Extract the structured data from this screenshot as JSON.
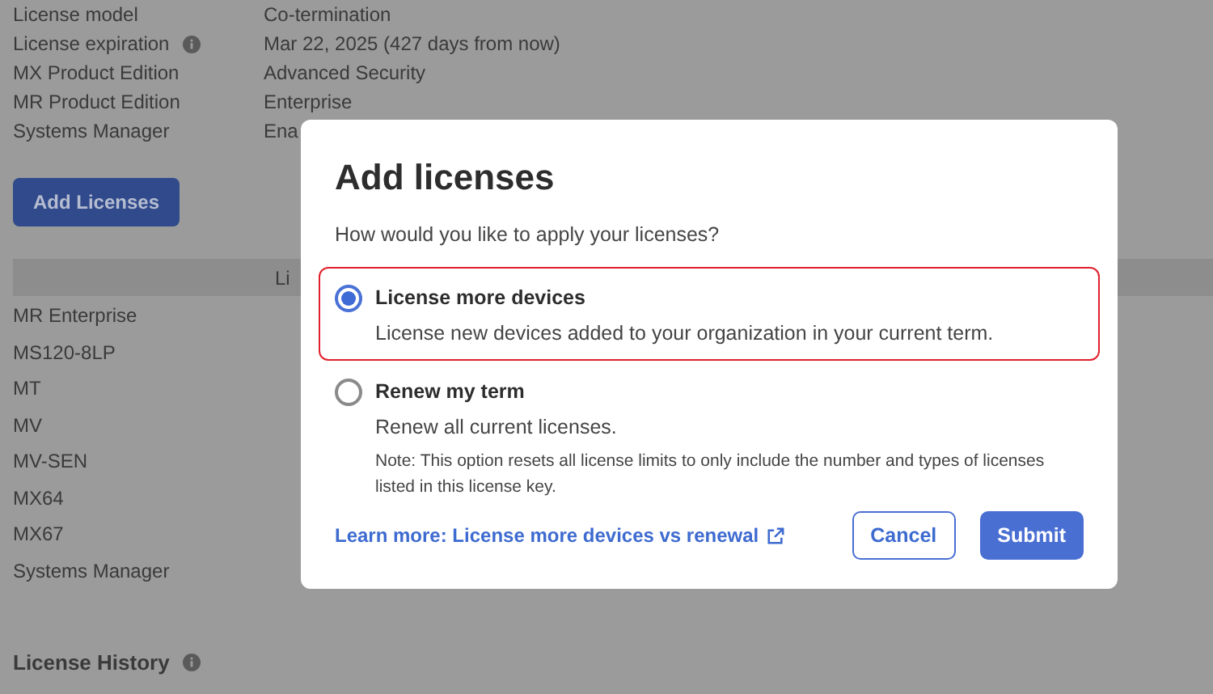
{
  "details": [
    {
      "label": "License model",
      "value": "Co-termination",
      "info": false
    },
    {
      "label": "License expiration",
      "value": "Mar 22, 2025 (427 days from now)",
      "info": true
    },
    {
      "label": "MX Product Edition",
      "value": "Advanced Security",
      "info": false
    },
    {
      "label": "MR Product Edition",
      "value": "Enterprise",
      "info": false
    },
    {
      "label": "Systems Manager",
      "value": "Ena",
      "info": false
    }
  ],
  "add_button": "Add Licenses",
  "table": {
    "header": "Li",
    "rows": [
      "MR Enterprise",
      "MS120-8LP",
      "MT",
      "MV",
      "MV-SEN",
      "MX64",
      "MX67",
      "Systems Manager"
    ]
  },
  "history_title": "License History",
  "dialog": {
    "title": "Add licenses",
    "question": "How would you like to apply your licenses?",
    "options": [
      {
        "label": "License more devices",
        "description": "License new devices added to your organization in your current term.",
        "selected": true
      },
      {
        "label": "Renew my term",
        "description": "Renew all current licenses.",
        "note": "Note: This option resets all license limits to only include the number and types of licenses listed in this license key.",
        "selected": false
      }
    ],
    "link": "Learn more: License more devices vs renewal",
    "buttons": [
      {
        "label": "Cancel",
        "kind": "secondary"
      },
      {
        "label": "Submit",
        "kind": "primary"
      }
    ]
  }
}
